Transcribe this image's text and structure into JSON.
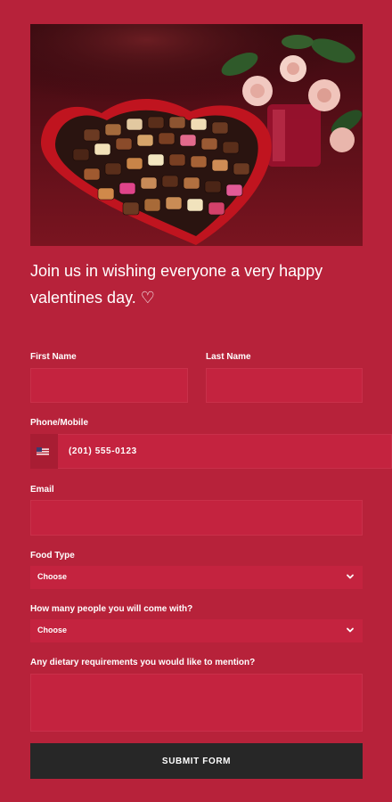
{
  "hero": {
    "image": "valentine-chocolate-box-with-roses"
  },
  "headline": {
    "text": "Join us in wishing everyone a very happy valentines day. ♡"
  },
  "form": {
    "first_name_label": "First Name",
    "last_name_label": "Last Name",
    "phone_label": "Phone/Mobile",
    "phone_flag": "us-flag-icon",
    "phone_value": "(201) 555-0123",
    "email_label": "Email",
    "food_type_label": "Food Type",
    "food_type_value": "Choose",
    "people_label": "How many people you will come with?",
    "people_value": "Choose",
    "dietary_label": "Any dietary requirements you would like to mention?",
    "submit_label": "SUBMIT FORM"
  },
  "colors": {
    "background": "#b7223a",
    "field": "#c4233f",
    "button": "#272727",
    "text": "#ffffff"
  }
}
